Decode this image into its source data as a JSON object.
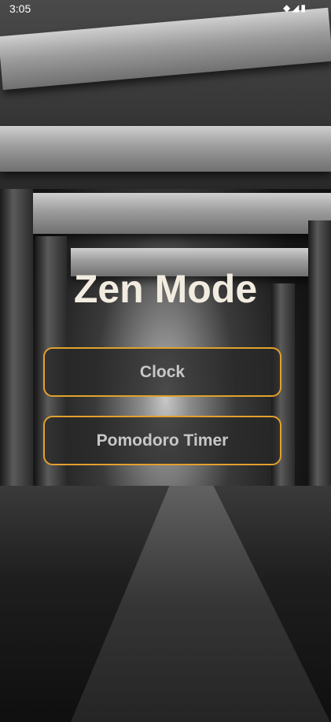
{
  "status_bar": {
    "time": "3:05",
    "icons": "◆◢▮"
  },
  "title": "Zen Mode",
  "buttons": [
    {
      "label": "Clock"
    },
    {
      "label": "Pomodoro Timer"
    }
  ],
  "colors": {
    "accent": "#e2a12c",
    "title": "#f2ece0",
    "button_text": "#c8c8c8"
  }
}
